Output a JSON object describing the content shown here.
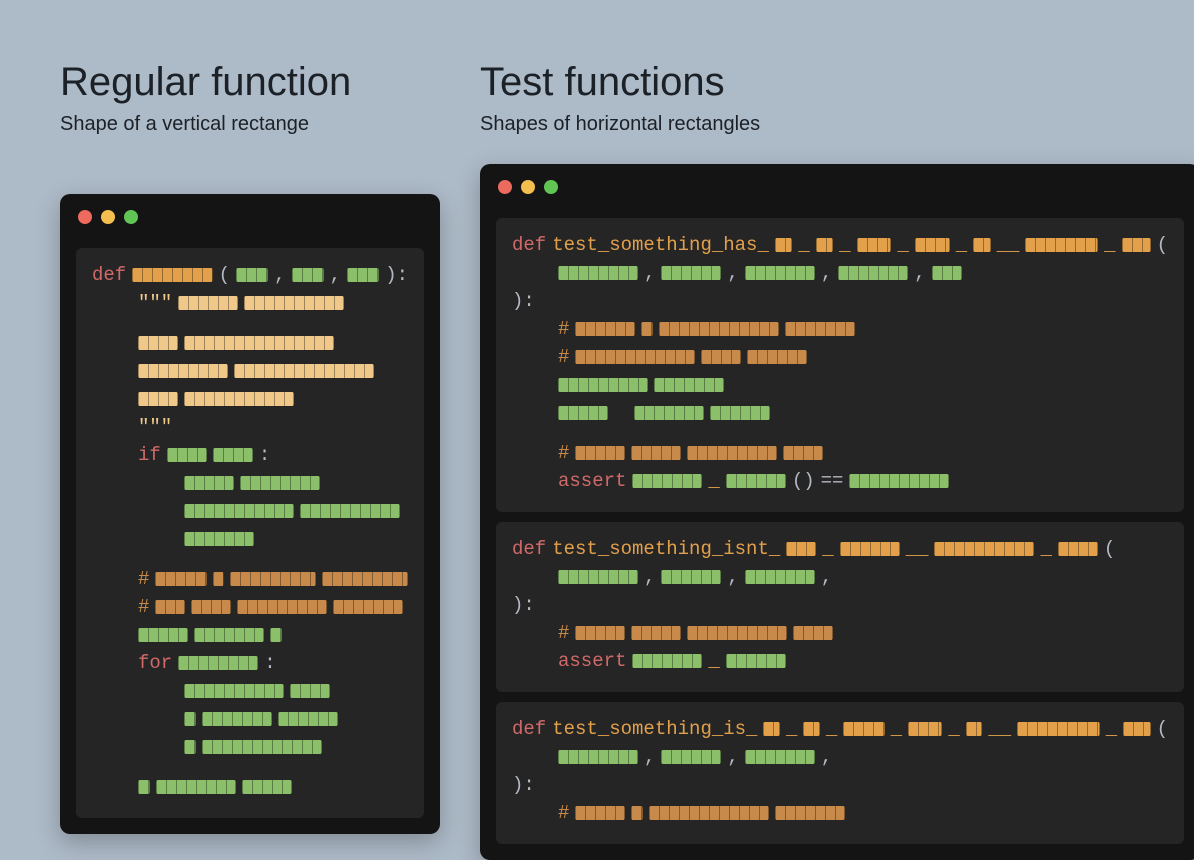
{
  "left": {
    "title": "Regular function",
    "subtitle": "Shape of a vertical rectange"
  },
  "right": {
    "title": "Test functions",
    "subtitle": "Shapes of horizontal rectangles"
  },
  "code": {
    "def": "def",
    "if": "if",
    "for": "for",
    "assert": "assert",
    "hash": "#",
    "triple_quote": "\"\"\"",
    "open_paren": "(",
    "close_paren": ")",
    "open_paren_colon": "):",
    "colon": ":",
    "eq": "==",
    "parens": "()",
    "comma": ",",
    "test1_name": "test_something_has_",
    "test2_name": "test_something_isnt_",
    "test3_name": "test_something_is_"
  },
  "colors": {
    "bg": "#adbac7",
    "window_bg": "#141414",
    "pane_bg": "#252525",
    "keyword": "#d16969",
    "function": "#e2a04b",
    "light_orange": "#f0c98a",
    "green": "#8bbf6a",
    "tan": "#c88a4a",
    "text": "#b3b9c2",
    "traffic_red": "#ed6a5e",
    "traffic_yellow": "#f5bf4f",
    "traffic_green": "#61c554"
  }
}
